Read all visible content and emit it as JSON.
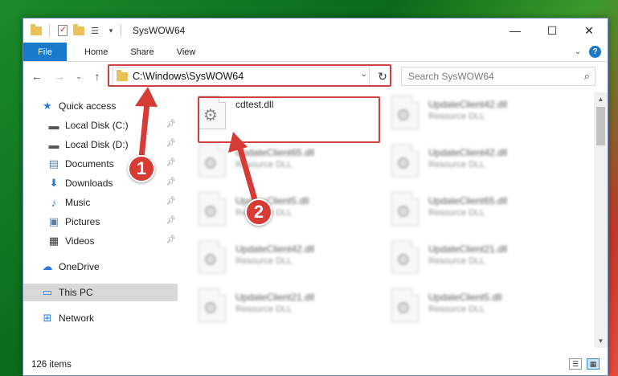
{
  "window": {
    "title": "SysWOW64"
  },
  "controls": {
    "minimize": "—",
    "maximize": "☐",
    "close": "✕"
  },
  "ribbon": {
    "tabs": [
      "File",
      "Home",
      "Share",
      "View"
    ],
    "help": "?"
  },
  "address": {
    "path": "C:\\Windows\\SysWOW64"
  },
  "search": {
    "placeholder": "Search SysWOW64"
  },
  "sidebar": {
    "items": [
      {
        "label": "Quick access",
        "icon": "star-icon",
        "pinned": false
      },
      {
        "label": "Local Disk (C:)",
        "icon": "drive-icon",
        "pinned": true
      },
      {
        "label": "Local Disk (D:)",
        "icon": "drive-icon",
        "pinned": true
      },
      {
        "label": "Documents",
        "icon": "documents-icon",
        "pinned": true
      },
      {
        "label": "Downloads",
        "icon": "download-icon",
        "pinned": true
      },
      {
        "label": "Music",
        "icon": "music-icon",
        "pinned": true
      },
      {
        "label": "Pictures",
        "icon": "pictures-icon",
        "pinned": true
      },
      {
        "label": "Videos",
        "icon": "videos-icon",
        "pinned": true
      },
      {
        "label": "OneDrive",
        "icon": "cloud-icon",
        "pinned": false
      },
      {
        "label": "This PC",
        "icon": "computer-icon",
        "pinned": false
      },
      {
        "label": "Network",
        "icon": "network-icon",
        "pinned": false
      }
    ]
  },
  "files": [
    {
      "name": "cdtest.dll",
      "type": "",
      "highlighted": true
    },
    {
      "name": "UpdateClient42.dll",
      "type": "Resource DLL"
    },
    {
      "name": "UpdateClient65.dll",
      "type": "Resource DLL"
    },
    {
      "name": "UpdateClient42.dll",
      "type": "Resource DLL"
    },
    {
      "name": "UpdateClient5.dll",
      "type": "Resource DLL"
    },
    {
      "name": "UpdateClient65.dll",
      "type": "Resource DLL"
    },
    {
      "name": "UpdateClient42.dll",
      "type": "Resource DLL"
    },
    {
      "name": "UpdateClient21.dll",
      "type": "Resource DLL"
    },
    {
      "name": "UpdateClient21.dll",
      "type": "Resource DLL"
    },
    {
      "name": "UpdateClient5.dll",
      "type": "Resource DLL"
    }
  ],
  "status": {
    "item_count": "126 items"
  },
  "annotations": {
    "step1": "1",
    "step2": "2",
    "color": "#d63b35"
  }
}
